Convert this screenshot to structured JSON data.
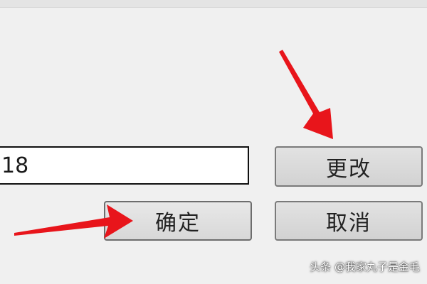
{
  "form": {
    "input_value": "18",
    "change_label": "更改",
    "confirm_label": "确定",
    "cancel_label": "取消"
  },
  "annotations": {
    "arrow_color": "#e8151b"
  },
  "watermark": {
    "text": "头条 @我家丸子是金毛"
  }
}
